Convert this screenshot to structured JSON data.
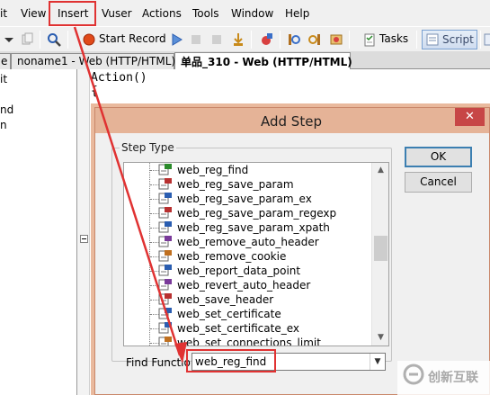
{
  "menubar": {
    "items": [
      "it",
      "View",
      "Insert",
      "Vuser",
      "Actions",
      "Tools",
      "Window",
      "Help"
    ]
  },
  "toolbar": {
    "start_record_label": "Start Record",
    "tasks_label": "Tasks",
    "script_label": "Script"
  },
  "tabs": [
    "e",
    "noname1 - Web (HTTP/HTML)",
    "单品_310 - Web (HTTP/HTML)"
  ],
  "left_pane": {
    "items": [
      "it",
      "nd",
      "n"
    ]
  },
  "editor": {
    "lines": [
      "Action()",
      "{"
    ]
  },
  "dialog": {
    "title": "Add Step",
    "close_symbol": "✕",
    "group_label": "Step Type",
    "steps": [
      "web_reg_find",
      "web_reg_save_param",
      "web_reg_save_param_ex",
      "web_reg_save_param_regexp",
      "web_reg_save_param_xpath",
      "web_remove_auto_header",
      "web_remove_cookie",
      "web_report_data_point",
      "web_revert_auto_header",
      "web_save_header",
      "web_set_certificate",
      "web_set_certificate_ex",
      "web_set_connections_limit"
    ],
    "ok_label": "OK",
    "cancel_label": "Cancel",
    "find_label": "Find Function:",
    "find_value": "web_reg_find"
  },
  "watermark": {
    "text": "创新互联"
  },
  "colors": {
    "annotation_red": "#e03232",
    "dialog_title": "#e5b397",
    "close_red": "#c74646"
  }
}
